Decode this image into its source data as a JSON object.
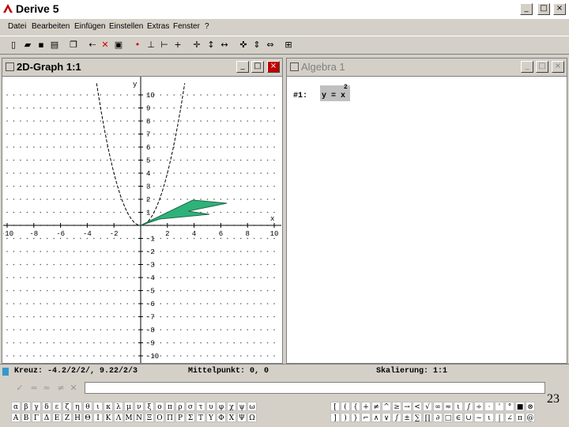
{
  "window": {
    "title": "Derive 5"
  },
  "menu": [
    "Datei",
    "Bearbeiten",
    "Einfügen",
    "Einstellen",
    "Extras",
    "Fenster",
    "?"
  ],
  "graph_window": {
    "title": "2D-Graph 1:1",
    "axis_x_label": "x",
    "axis_y_label": "y",
    "x_ticks": [
      "-10",
      "-8",
      "-6",
      "-4",
      "-2",
      "2",
      "4",
      "6",
      "8",
      "10"
    ],
    "y_ticks": [
      "10",
      "9",
      "8",
      "7",
      "6",
      "5",
      "4",
      "3",
      "2",
      "1",
      "-1",
      "-2",
      "-3",
      "-4",
      "-5",
      "-6",
      "-7",
      "-8",
      "-9",
      "-10"
    ],
    "accent_shape_color": "#2fb27a"
  },
  "algebra_window": {
    "title": "Algebra 1",
    "expr_label": "#1:",
    "expr_text": "y = x",
    "expr_exponent": "2"
  },
  "status": {
    "cross": "Kreuz: -4.2/2/2/, 9.22/2/3",
    "center": "Mittelpunkt: 0, 0",
    "scale": "Skalierung: 1:1"
  },
  "greek_lower": [
    "α",
    "β",
    "γ",
    "δ",
    "ε",
    "ζ",
    "η",
    "θ",
    "ι",
    "κ",
    "λ",
    "μ",
    "ν",
    "ξ",
    "ο",
    "π",
    "ρ",
    "σ",
    "τ",
    "υ",
    "φ",
    "χ",
    "ψ",
    "ω"
  ],
  "greek_upper": [
    "Α",
    "Β",
    "Γ",
    "Δ",
    "Ε",
    "Ζ",
    "Η",
    "Θ",
    "Ι",
    "Κ",
    "Λ",
    "Μ",
    "Ν",
    "Ξ",
    "Ο",
    "Π",
    "Ρ",
    "Σ",
    "Τ",
    "Υ",
    "Φ",
    "Χ",
    "Ψ",
    "Ω"
  ],
  "math_row1": [
    "[",
    "(",
    "{",
    "+",
    "≠",
    "^",
    "≥",
    "→",
    "<",
    "√",
    "∞",
    "≈",
    "ι",
    "∫",
    "÷",
    "·",
    "'",
    "°",
    "■",
    "⊗"
  ],
  "math_row2": [
    "]",
    ")",
    "}",
    "⌐",
    "∧",
    "∨",
    "∫",
    "±",
    "∑",
    "∏",
    "∂",
    "□",
    "∈",
    "∪",
    "~",
    "ι",
    "|",
    "∠",
    "π",
    "@"
  ],
  "slide_number": "23"
}
